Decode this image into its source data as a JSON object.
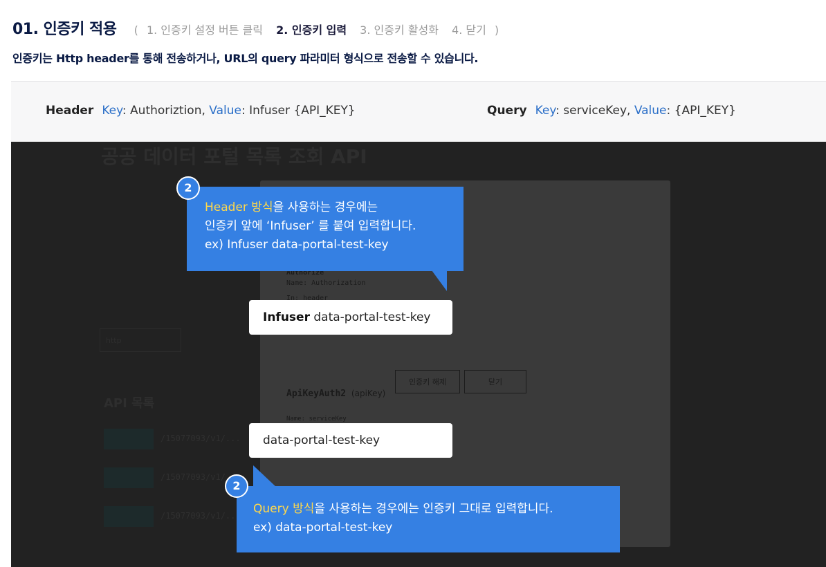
{
  "heading": {
    "title": "01. 인증키 적용",
    "paren_open": "(",
    "paren_close": ")",
    "steps": [
      "1. 인증키 설정 버튼 클릭",
      "2. 인증키 입력",
      "3. 인증키 활성화",
      "4. 닫기"
    ],
    "active_step_index": 1
  },
  "subtitle": "인증키는 Http header를 통해 전송하거나, URL의 query 파라미터 형식으로 전송할 수 있습니다.",
  "info": {
    "header": {
      "label": "Header",
      "key_label": "Key",
      "key_value": ": Authoriztion,",
      "value_label": "Value",
      "value_value": ": Infuser {API_KEY}"
    },
    "query": {
      "label": "Query",
      "key_label": "Key",
      "key_value": ": serviceKey,",
      "value_label": "Value",
      "value_value": ": {API_KEY}"
    }
  },
  "background": {
    "page_title": "공공 데이터 포털 목록 조회 API",
    "api_list_title": "API 목록",
    "server_select": "http",
    "api_paths": [
      "/15077093/v1/...",
      "/15077093/v1/...",
      "/15077093/v1/..."
    ]
  },
  "modal": {
    "auth1_title": "Authorize",
    "auth1_name": "Name: Authorization",
    "auth1_in": "In: header",
    "logout_button": "인증키 해제",
    "close_button": "닫기",
    "auth2_title": "ApiKeyAuth2",
    "auth2_type": "(apiKey)",
    "auth2_name": "Name: serviceKey"
  },
  "header_input": {
    "prefix": "Infuser",
    "value": " data-portal-test-key"
  },
  "query_input": {
    "value": "data-portal-test-key"
  },
  "callout_header": {
    "badge": "2",
    "line1_highlight": "Header 방식",
    "line1_rest": "을 사용하는 경우에는",
    "line2": "인증키 앞에 ‘Infuser’ 를 붙여 입력합니다.",
    "line3": "ex) Infuser data-portal-test-key"
  },
  "callout_query": {
    "badge": "2",
    "line1_highlight": "Query 방식",
    "line1_rest": "을 사용하는 경우에는 인증키 그대로 입력합니다.",
    "line2": "ex)  data-portal-test-key"
  },
  "colors": {
    "callout_blue": "#3580e3",
    "highlight_yellow": "#ffd84a",
    "key_blue": "#2b6fc8",
    "title_navy": "#0a1a44",
    "overlay_dark": "#222222"
  }
}
